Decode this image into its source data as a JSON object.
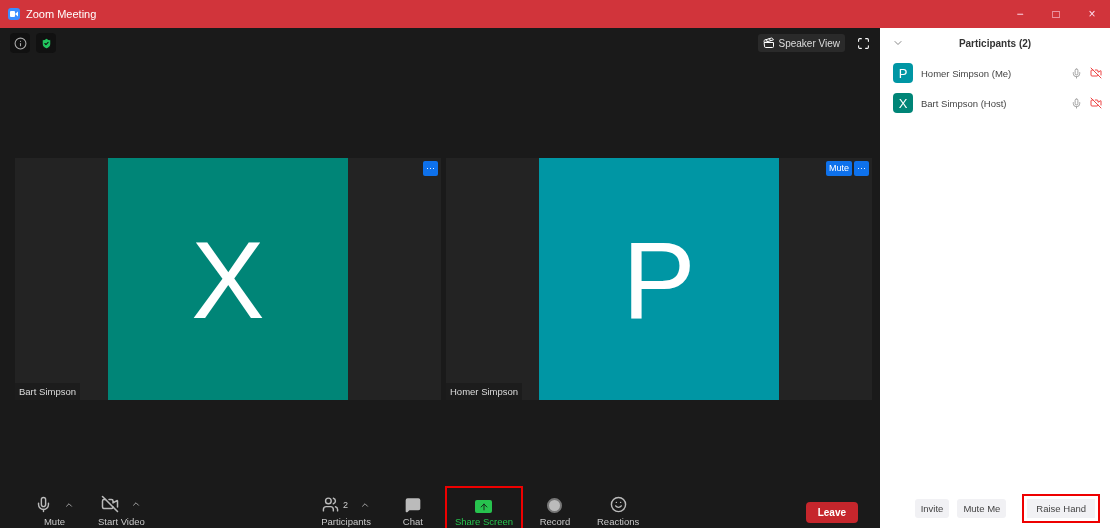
{
  "window": {
    "title": "Zoom Meeting",
    "controls": [
      "−",
      "□",
      "×"
    ]
  },
  "top_bar": {
    "view_button": "Speaker View"
  },
  "tiles": [
    {
      "name": "Bart Simpson",
      "initial": "X",
      "color": "#008577",
      "buttons": [
        "···"
      ]
    },
    {
      "name": "Homer Simpson",
      "initial": "P",
      "color": "#0096a4",
      "buttons": [
        "Mute",
        "···"
      ]
    }
  ],
  "toolbar": [
    {
      "kind": "mic",
      "label": "Mute",
      "caret": true,
      "highlighted": false
    },
    {
      "kind": "video-off",
      "label": "Start Video",
      "caret": true,
      "highlighted": false
    },
    {
      "kind": "spacer"
    },
    {
      "kind": "participants",
      "label": "Participants",
      "count": "2",
      "caret": true,
      "highlighted": false
    },
    {
      "kind": "chat",
      "label": "Chat",
      "caret": false,
      "highlighted": false
    },
    {
      "kind": "share",
      "label": "Share Screen",
      "caret": false,
      "highlighted": true
    },
    {
      "kind": "record",
      "label": "Record",
      "caret": false,
      "highlighted": false
    },
    {
      "kind": "reactions",
      "label": "Reactions",
      "caret": false,
      "highlighted": false
    },
    {
      "kind": "spacer"
    },
    {
      "kind": "leave",
      "label": "Leave"
    }
  ],
  "panel": {
    "title": "Participants (2)",
    "participants": [
      {
        "initial": "P",
        "name": "Homer Simpson (Me)",
        "color": "#0096a4"
      },
      {
        "initial": "X",
        "name": "Bart Simpson (Host)",
        "color": "#008577"
      }
    ],
    "buttons": [
      {
        "label": "Invite",
        "highlighted": false
      },
      {
        "label": "Mute Me",
        "highlighted": false
      },
      {
        "label": "Raise Hand",
        "highlighted": true
      }
    ]
  }
}
